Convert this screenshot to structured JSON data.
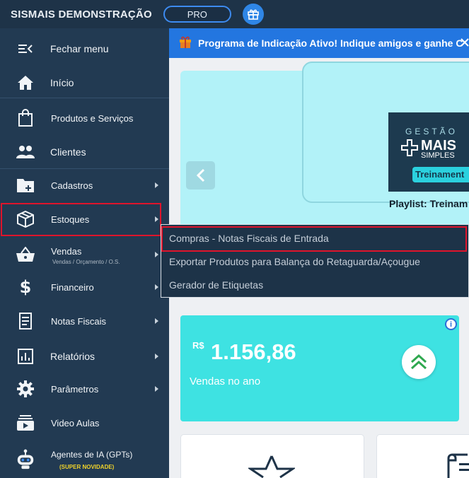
{
  "topbar": {
    "brand": "SISMAIS DEMONSTRAÇÃO",
    "plan_badge": "PRO",
    "gift_icon": "gift-icon"
  },
  "sidebar": {
    "items": [
      {
        "label": "Fechar menu",
        "icon": "menu-close-icon"
      },
      {
        "label": "Início",
        "icon": "home-icon"
      },
      {
        "label": "Produtos e Serviços",
        "icon": "shopping-bag-icon"
      },
      {
        "label": "Clientes",
        "icon": "people-icon"
      },
      {
        "label": "Cadastros",
        "icon": "folder-plus-icon"
      },
      {
        "label": "Estoques",
        "icon": "box-icon"
      },
      {
        "label": "Vendas",
        "icon": "basket-icon",
        "sublabel": "Vendas / Orçamento / O.S."
      },
      {
        "label": "Financeiro",
        "icon": "dollar-icon"
      },
      {
        "label": "Notas Fiscais",
        "icon": "receipt-icon"
      },
      {
        "label": "Relatórios",
        "icon": "bar-chart-icon"
      },
      {
        "label": "Parâmetros",
        "icon": "gear-icon"
      },
      {
        "label": "Video Aulas",
        "icon": "video-icon"
      },
      {
        "label": "Agentes de IA (GPTs)",
        "icon": "robot-icon",
        "badge": "(SUPER NOVIDADE)"
      }
    ]
  },
  "banner": {
    "text": "Programa de Indicação Ativo! Indique amigos e ganhe C"
  },
  "carousel": {
    "thumb_line1": "GESTÃO",
    "thumb_line2": "MAIS",
    "thumb_line3": "SIMPLES",
    "thumb_tag": "Treinament",
    "caption": "Playlist: Treinam"
  },
  "dropdown": {
    "items": [
      "Compras - Notas Fiscais de Entrada",
      "Exportar Produtos para Balança do Retaguarda/Açougue",
      "Gerador de Etiquetas"
    ]
  },
  "sales_card": {
    "currency": "R$",
    "amount": "1.156,86",
    "label": "Vendas no ano",
    "info": "i"
  },
  "colors": {
    "sidebar_bg": "#223a52",
    "accent": "#2376e0",
    "sales_bg": "#3ee2e2",
    "highlight": "#e0142b"
  }
}
